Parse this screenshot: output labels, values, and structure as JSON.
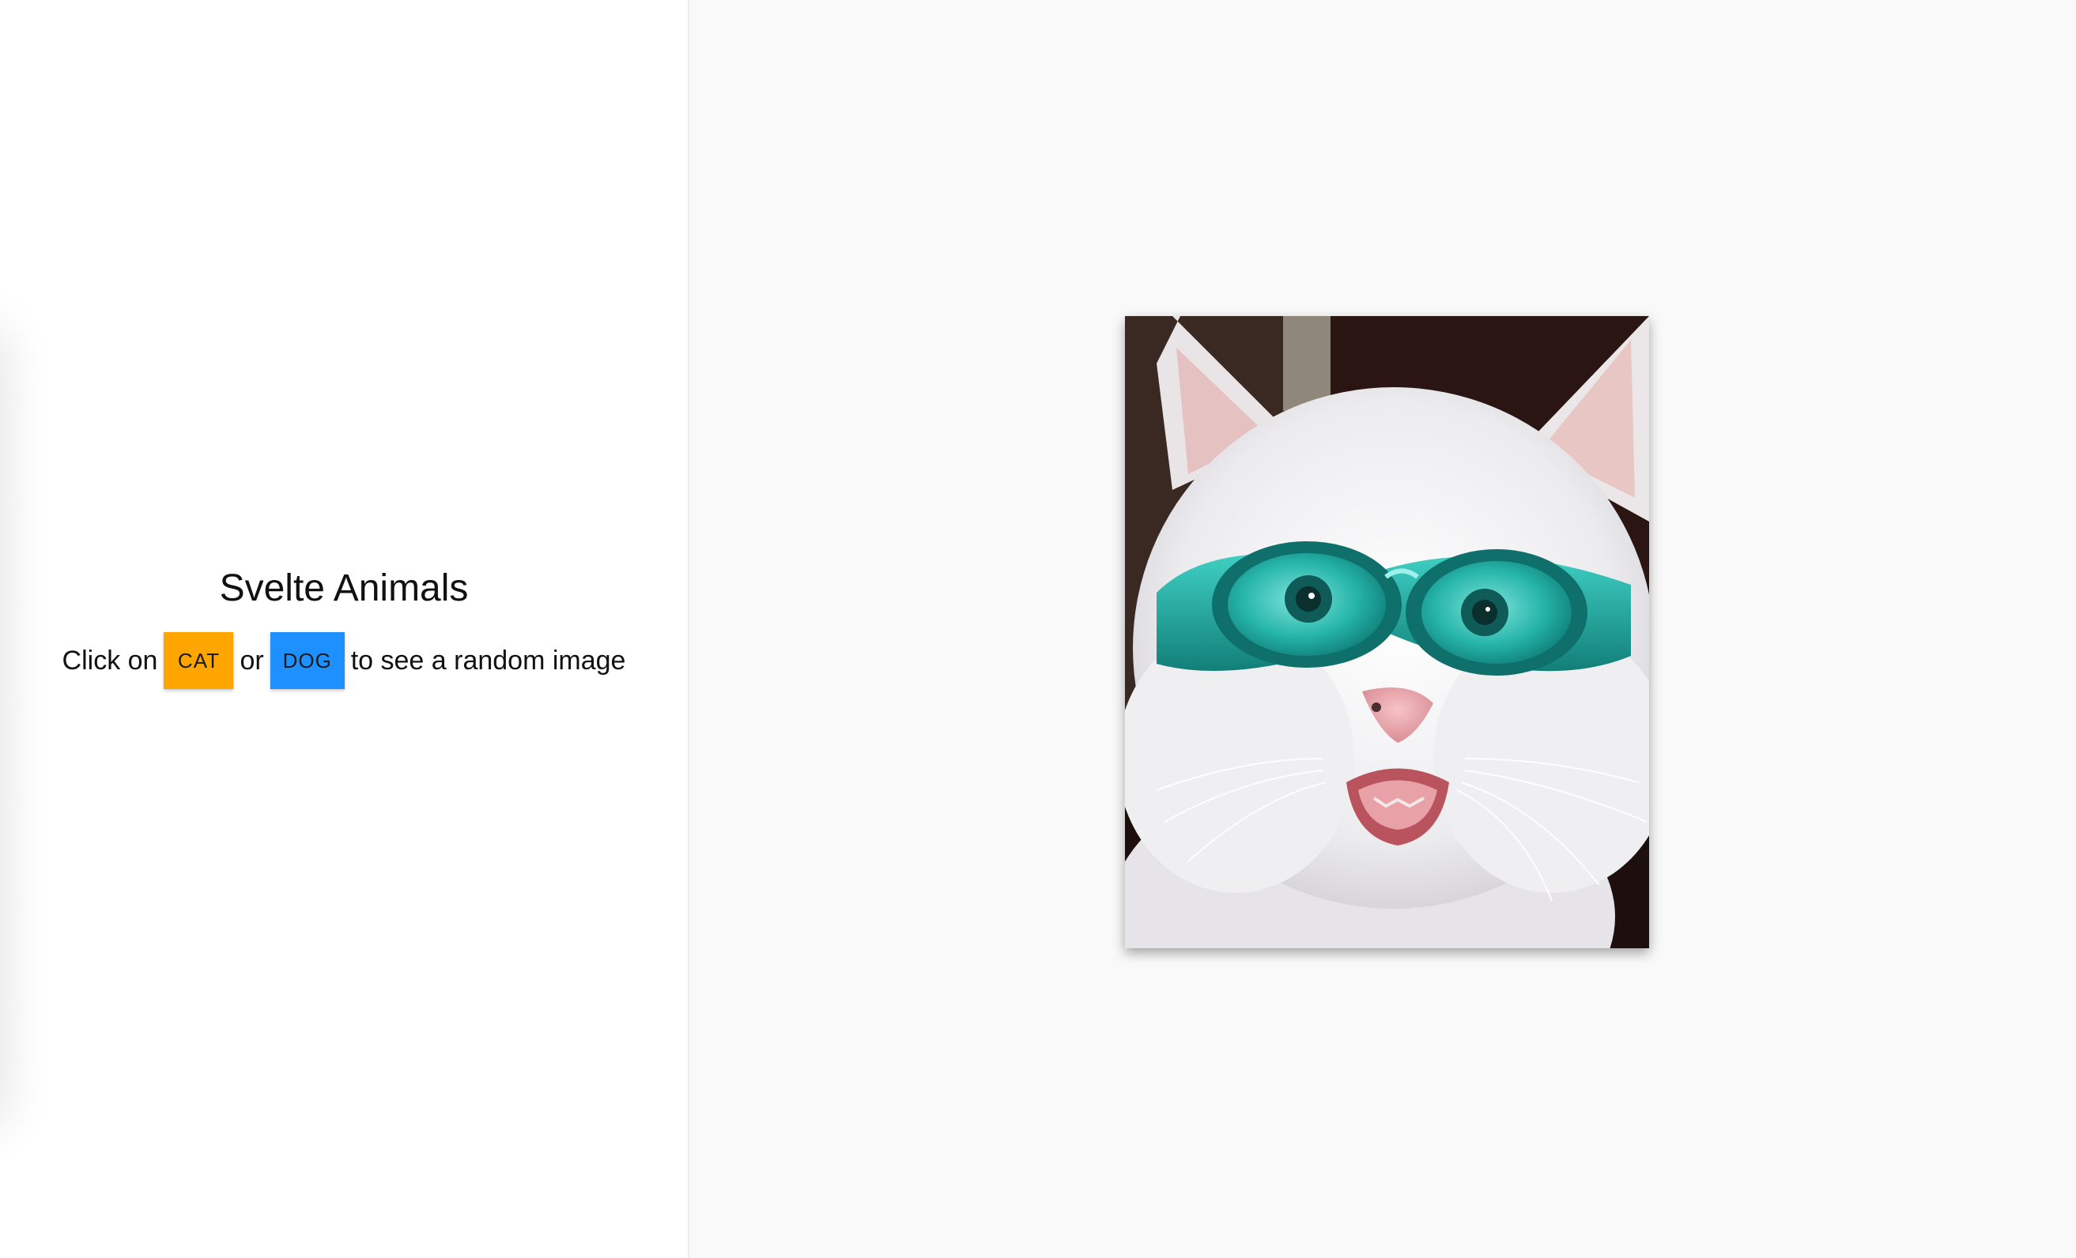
{
  "page": {
    "title": "Svelte Animals"
  },
  "instructions": {
    "prefix": "Click on",
    "middle": "or",
    "suffix": "to see a random image"
  },
  "buttons": {
    "cat_label": "CAT",
    "dog_label": "DOG"
  },
  "image": {
    "subject": "white cat wearing teal goggles"
  },
  "colors": {
    "cat_button": "#ffa500",
    "dog_button": "#1e90ff",
    "left_background": "#ffffff",
    "right_background": "#f9f9f9"
  }
}
